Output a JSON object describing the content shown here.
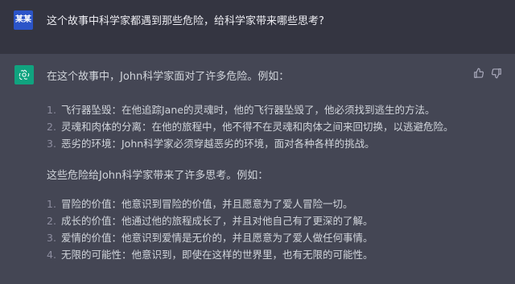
{
  "user": {
    "avatar_text": "某某",
    "question": "这个故事中科学家都遇到那些危险，给科学家带来哪些思考?"
  },
  "assistant": {
    "intro": "在这个故事中，John科学家面对了许多危险。例如：",
    "dangers": [
      {
        "num": "1.",
        "text": "飞行器坠毁：在他追踪Jane的灵魂时，他的飞行器坠毁了，他必须找到逃生的方法。"
      },
      {
        "num": "2.",
        "text": "灵魂和肉体的分离：在他的旅程中，他不得不在灵魂和肉体之间来回切换，以逃避危险。"
      },
      {
        "num": "3.",
        "text": "恶劣的环境：John科学家必须穿越恶劣的环境，面对各种各样的挑战。"
      }
    ],
    "mid": "这些危险给John科学家带来了许多思考。例如：",
    "thoughts": [
      {
        "num": "1.",
        "text": "冒险的价值：他意识到冒险的价值，并且愿意为了爱人冒险一切。"
      },
      {
        "num": "2.",
        "text": "成长的价值：他通过他的旅程成长了，并且对他自己有了更深的了解。"
      },
      {
        "num": "3.",
        "text": "爱情的价值：他意识到爱情是无价的，并且愿意为了爱人做任何事情。"
      },
      {
        "num": "4.",
        "text": "无限的可能性：他意识到，即使在这样的世界里，也有无限的可能性。"
      }
    ]
  },
  "icons": {
    "assistant_avatar": "openai-logo-icon",
    "like": "thumbs-up-icon",
    "dislike": "thumbs-down-icon"
  },
  "colors": {
    "user_bg": "#343541",
    "assistant_bg": "#444654",
    "avatar_blue": "#2b54c8",
    "gpt_green": "#10a37f"
  }
}
